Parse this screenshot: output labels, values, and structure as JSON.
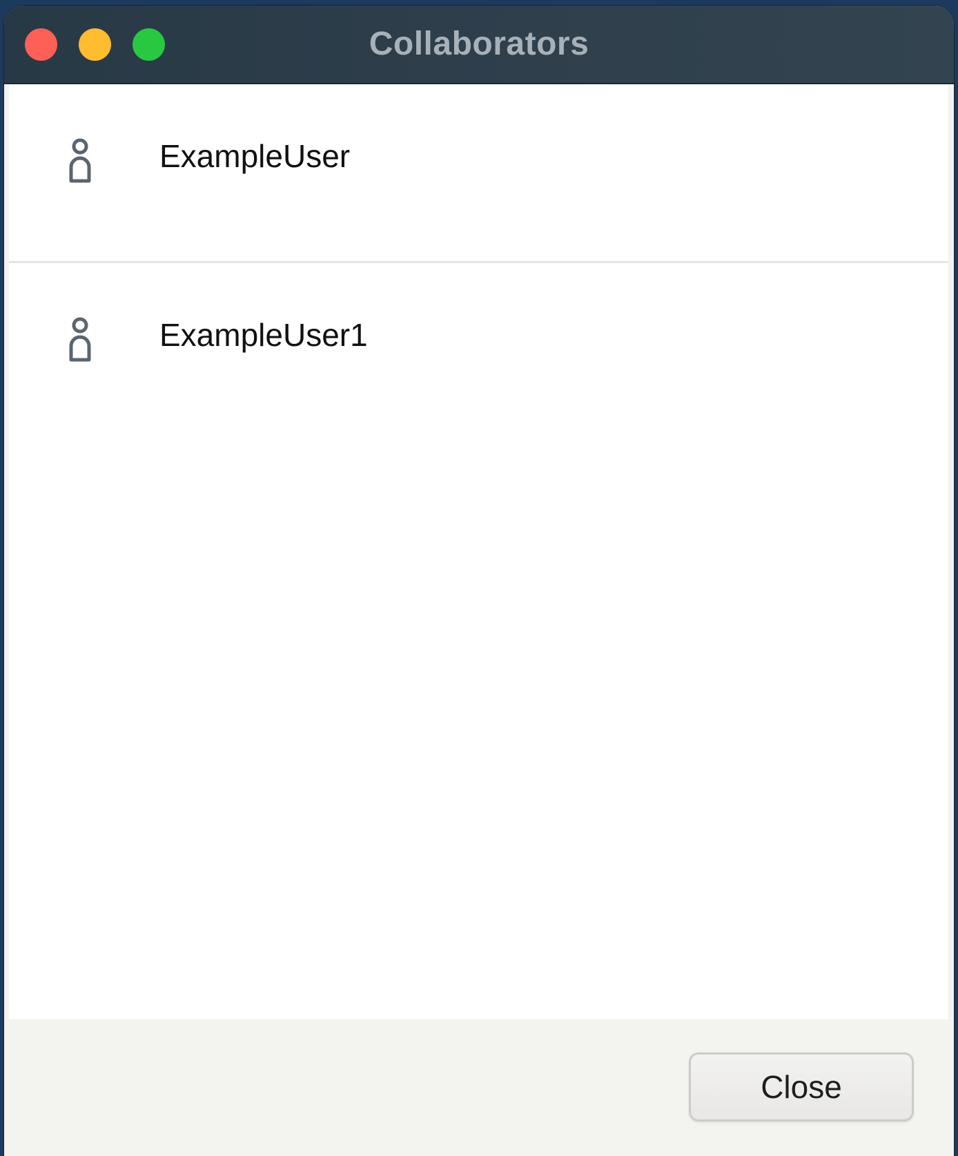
{
  "window": {
    "title": "Collaborators"
  },
  "controls": {
    "close_color": "#ff5f57",
    "minimize_color": "#febc2e",
    "zoom_color": "#28c840"
  },
  "collaborators": [
    {
      "name": "ExampleUser",
      "icon": "user-icon"
    },
    {
      "name": "ExampleUser1",
      "icon": "user-icon"
    }
  ],
  "footer": {
    "close_label": "Close"
  },
  "colors": {
    "titlebar": "#2c3c48",
    "title_text": "#a7b1b9",
    "icon": "#5b6570"
  }
}
